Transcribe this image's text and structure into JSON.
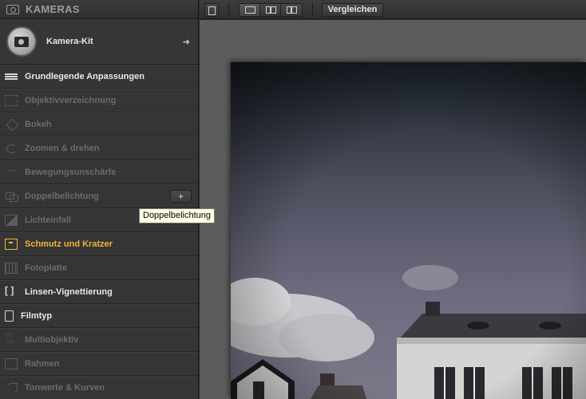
{
  "sidebar": {
    "header_title": "KAMERAS",
    "kit_label": "Kamera-Kit",
    "kit_arrow": "➜",
    "items": [
      {
        "label": "Grundlegende Anpassungen",
        "state": "active",
        "icon": "sliders-icon"
      },
      {
        "label": "Objektivverzeichnung",
        "state": "disabled",
        "icon": "distortion-icon"
      },
      {
        "label": "Bokeh",
        "state": "disabled",
        "icon": "bokeh-icon"
      },
      {
        "label": "Zoomen & drehen",
        "state": "disabled",
        "icon": "rotate-icon"
      },
      {
        "label": "Bewegungsunschärfe",
        "state": "disabled",
        "icon": "motion-blur-icon"
      },
      {
        "label": "Doppelbelichtung",
        "state": "disabled",
        "icon": "double-exposure-icon",
        "add_label": "+"
      },
      {
        "label": "Lichteinfall",
        "state": "disabled",
        "icon": "light-leak-icon"
      },
      {
        "label": "Schmutz und Kratzer",
        "state": "highlight",
        "icon": "dirt-scratches-icon"
      },
      {
        "label": "Fotoplatte",
        "state": "disabled",
        "icon": "photo-plate-icon"
      },
      {
        "label": "Linsen-Vignettierung",
        "state": "active",
        "icon": "vignette-icon"
      },
      {
        "label": "Filmtyp",
        "state": "active",
        "icon": "film-type-icon"
      },
      {
        "label": "Multiobjektiv",
        "state": "disabled",
        "icon": "multi-lens-icon"
      },
      {
        "label": "Rahmen",
        "state": "disabled",
        "icon": "frame-icon"
      },
      {
        "label": "Tonwerte & Kurven",
        "state": "disabled",
        "icon": "curves-icon"
      }
    ]
  },
  "tooltip": "Doppelbelichtung",
  "toolbar": {
    "compare_label": "Vergleichen"
  },
  "colors": {
    "highlight": "#f0b43a",
    "active_text": "#e8e8e8",
    "disabled_text": "#6c6c6c",
    "canvas_bg": "#5c5c5c"
  }
}
